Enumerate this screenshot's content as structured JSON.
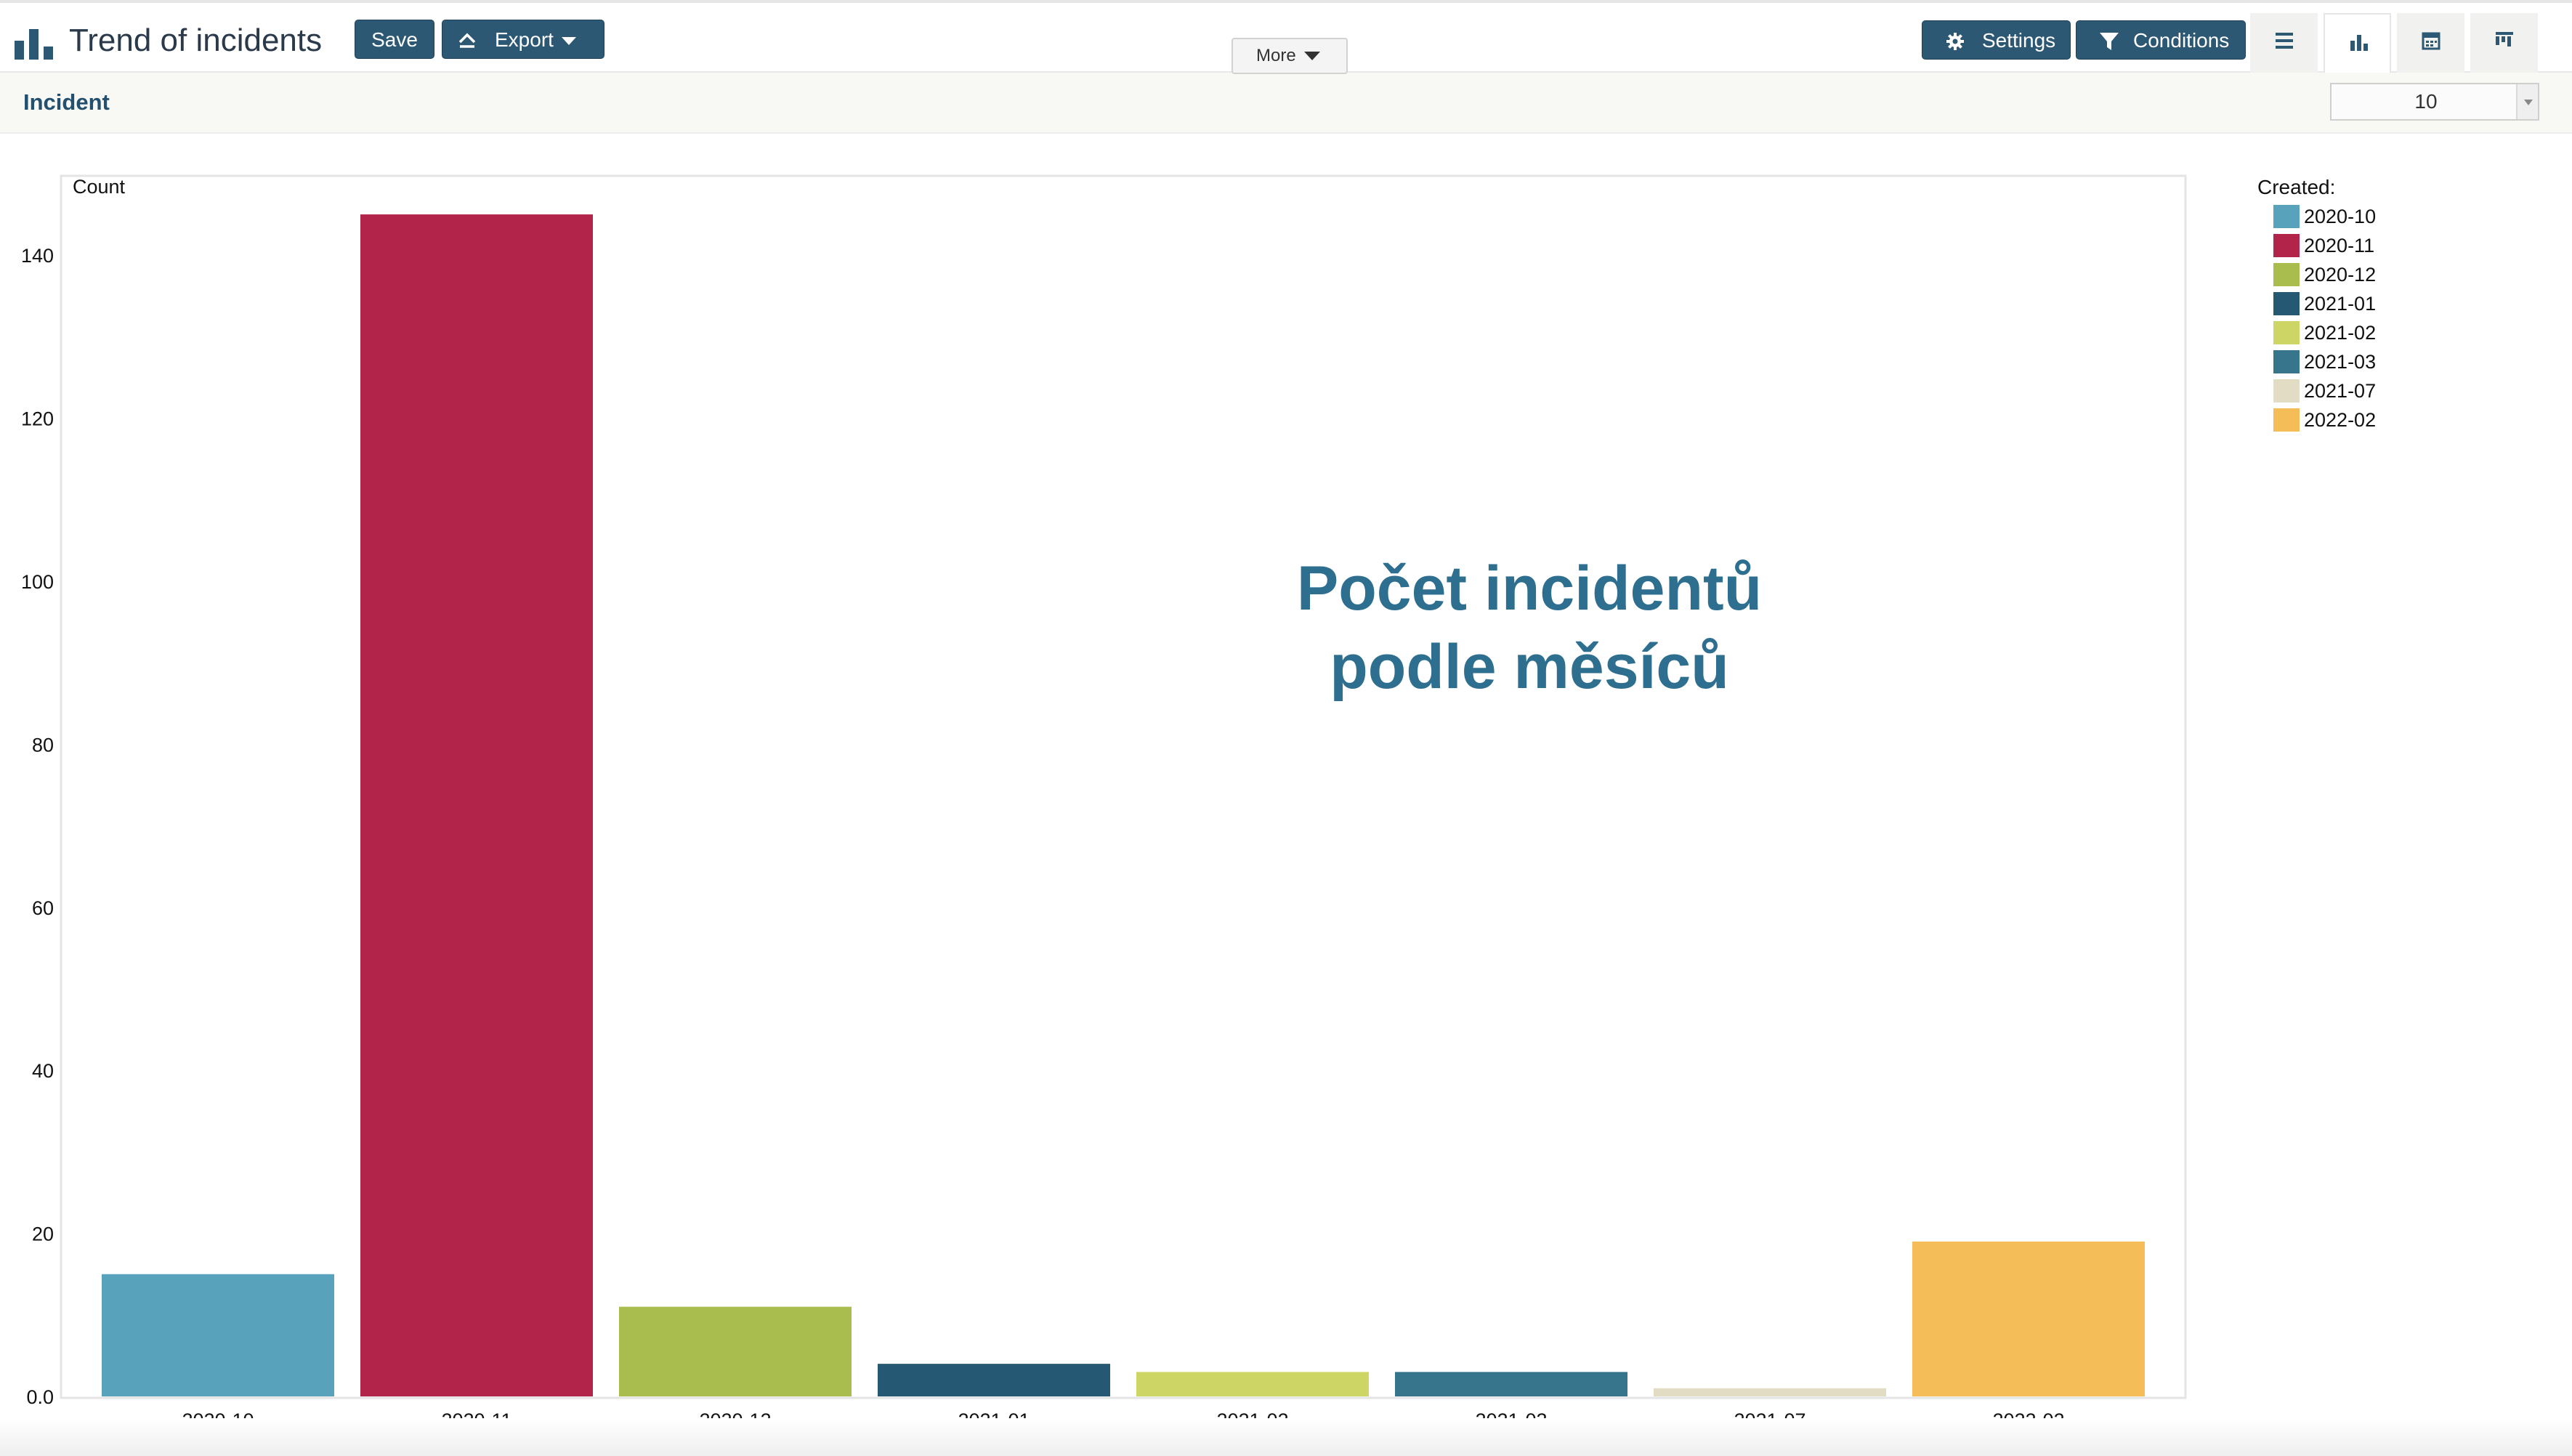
{
  "toolbar": {
    "title": "Trend of incidents",
    "save_label": "Save",
    "export_label": "Export",
    "settings_label": "Settings",
    "conditions_label": "Conditions",
    "accent_color": "#2d5873"
  },
  "subbar": {
    "entity": "Incident",
    "more_label": "More",
    "limit_value": "10"
  },
  "overlay": {
    "line1": "Počet incidentů",
    "line2": "podle měsíců"
  },
  "chart_data": {
    "type": "bar",
    "title": "",
    "xlabel": "",
    "ylabel": "Count",
    "categories": [
      "2020-10",
      "2020-11",
      "2020-12",
      "2021-01",
      "2021-02",
      "2021-03",
      "2021-07",
      "2022-02"
    ],
    "values": [
      15,
      145,
      11,
      4,
      3,
      3,
      1,
      19
    ],
    "colors": [
      "#58a2bb",
      "#b3244b",
      "#a9bc4e",
      "#245873",
      "#cdd664",
      "#37758c",
      "#e2dcc4",
      "#f5bd58"
    ],
    "ylim": [
      0,
      150
    ],
    "yticks": [
      "0.0",
      "20",
      "40",
      "60",
      "80",
      "100",
      "120",
      "140"
    ],
    "legend_title": "Created:",
    "legend_position": "right",
    "grid": false
  }
}
